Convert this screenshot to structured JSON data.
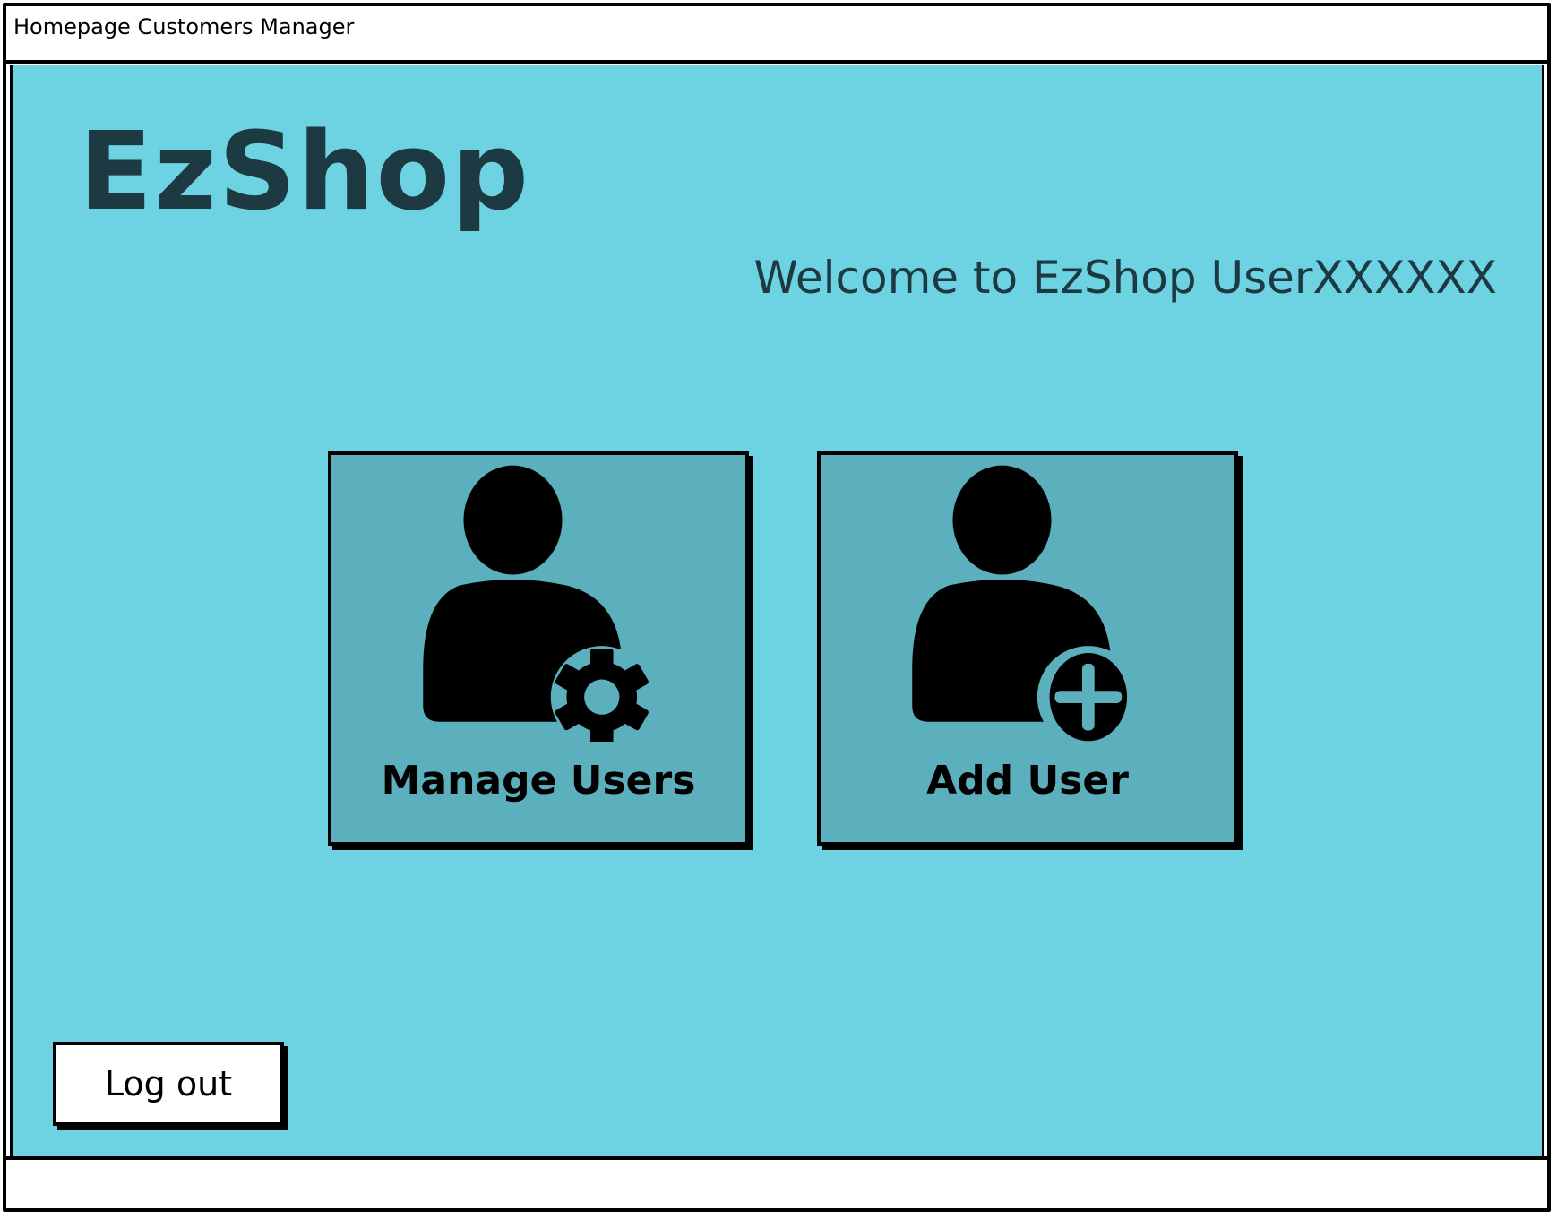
{
  "window": {
    "title": "Homepage Customers Manager"
  },
  "header": {
    "logo_text": "EzShop",
    "welcome_text": "Welcome to EzShop UserXXXXXX"
  },
  "tiles": [
    {
      "label": "Manage Users",
      "icon": "user-gear-icon"
    },
    {
      "label": "Add User",
      "icon": "user-plus-icon"
    }
  ],
  "footer": {
    "logout_label": "Log out"
  },
  "colors": {
    "background": "#6dd2e2",
    "tile": "#5cb0bd",
    "heading": "#1d3a42"
  }
}
